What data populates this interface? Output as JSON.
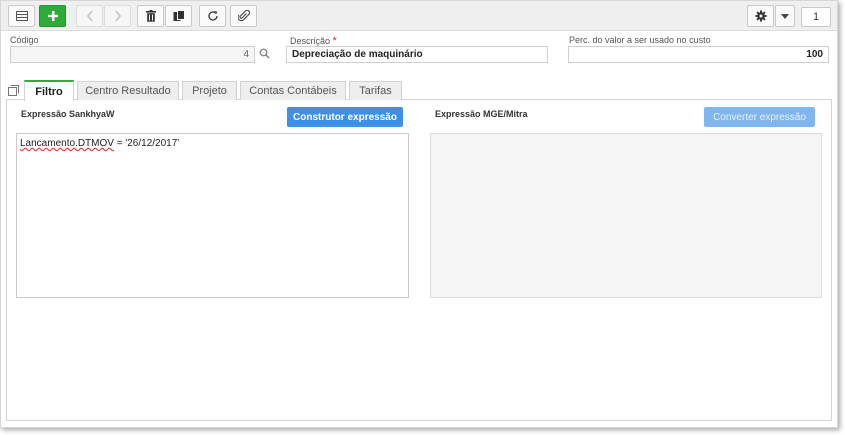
{
  "toolbar": {
    "buttons": [
      "grid-view",
      "add",
      "previous",
      "next",
      "delete",
      "copy",
      "refresh",
      "attach"
    ],
    "page_number": "1"
  },
  "fields": {
    "codigo": {
      "label": "Código",
      "value": "4"
    },
    "descricao": {
      "label": "Descrição",
      "required_mark": "*",
      "value": "Depreciação de maquinário"
    },
    "percentual": {
      "label": "Perc. do valor a ser usado no custo",
      "value": "100"
    }
  },
  "tabs": [
    {
      "label": "Filtro",
      "active": true
    },
    {
      "label": "Centro Resultado",
      "active": false
    },
    {
      "label": "Projeto",
      "active": false
    },
    {
      "label": "Contas Contábeis",
      "active": false
    },
    {
      "label": "Tarifas",
      "active": false
    }
  ],
  "filtro": {
    "left_title": "Expressão SankhyaW",
    "left_button": "Construtor expressão",
    "code_identifier": "Lancamento.DTMOV",
    "code_rest": " = '26/12/2017'",
    "right_title": "Expressão MGE/Mitra",
    "right_button": "Converter expressão"
  },
  "colors": {
    "accent_green": "#2eab3a",
    "button_blue": "#3d8fe8",
    "required_red": "#d9262c"
  }
}
